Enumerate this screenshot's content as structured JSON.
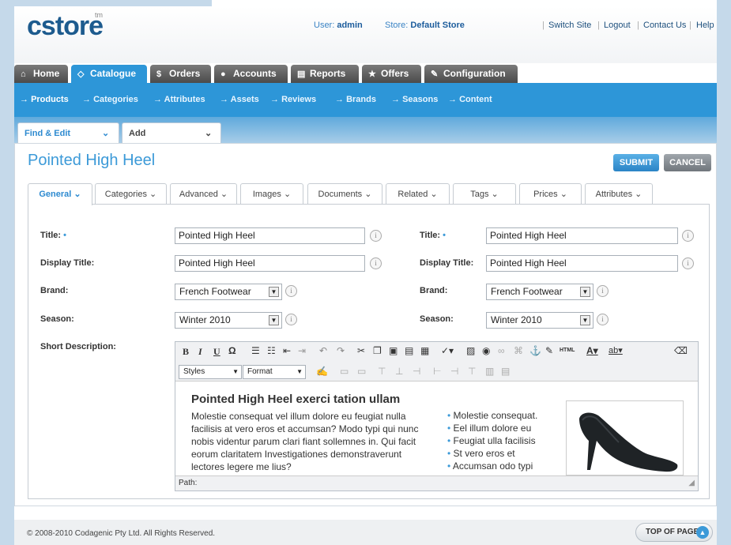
{
  "header": {
    "logo": "cstore",
    "logo_tm": "tm",
    "user_label": "User:",
    "user_value": "admin",
    "store_label": "Store:",
    "store_value": "Default Store",
    "links": [
      "Switch Site",
      "Logout",
      "Contact Us",
      "Help"
    ]
  },
  "nav": {
    "tabs": [
      {
        "label": "Home",
        "icon": "home-icon"
      },
      {
        "label": "Catalogue",
        "icon": "tag-icon",
        "active": true
      },
      {
        "label": "Orders",
        "icon": "dollar-icon"
      },
      {
        "label": "Accounts",
        "icon": "user-icon"
      },
      {
        "label": "Reports",
        "icon": "document-icon"
      },
      {
        "label": "Offers",
        "icon": "star-icon"
      },
      {
        "label": "Configuration",
        "icon": "wrench-icon"
      }
    ],
    "subnav": [
      "Products",
      "Categories",
      "Attributes",
      "Assets",
      "Reviews",
      "Brands",
      "Seasons",
      "Content"
    ]
  },
  "toolbar": {
    "find_edit": "Find & Edit",
    "add": "Add"
  },
  "page": {
    "title": "Pointed High Heel",
    "submit": "SUBMIT",
    "cancel": "CANCEL"
  },
  "tabs": [
    "General",
    "Categories",
    "Advanced",
    "Images",
    "Documents",
    "Related",
    "Tags",
    "Prices",
    "Attributes"
  ],
  "form": {
    "title_label": "Title:",
    "display_title_label": "Display Title:",
    "brand_label": "Brand:",
    "season_label": "Season:",
    "short_desc_label": "Short Description:",
    "required_mark": "•",
    "left": {
      "title": "Pointed High Heel",
      "display_title": "Pointed High Heel",
      "brand": "French Footwear",
      "season": "Winter 2010"
    },
    "right": {
      "title": "Pointed High Heel",
      "display_title": "Pointed High Heel",
      "brand": "French Footwear",
      "season": "Winter 2010"
    }
  },
  "editor": {
    "styles": "Styles",
    "format": "Format",
    "html_btn": "HTML",
    "heading": "Pointed High Heel exerci tation ullam",
    "paragraph": "Molestie consequat vel illum dolore eu feugiat nulla facilisis at vero eros et accumsan? Modo typi qui nunc nobis videntur parum clari fiant sollemnes in. Qui facit eorum claritatem Investigationes demonstraverunt lectores legere me lius?",
    "bullets": [
      "Molestie consequat.",
      "Eel illum dolore eu",
      "Feugiat ulla facilisis",
      "St vero eros et",
      "Accumsan odo typi"
    ],
    "path_label": "Path:"
  },
  "footer": {
    "copyright": "© 2008-2010 Codagenic Pty Ltd. All Rights Reserved.",
    "top_of_page": "TOP OF PAGE"
  }
}
